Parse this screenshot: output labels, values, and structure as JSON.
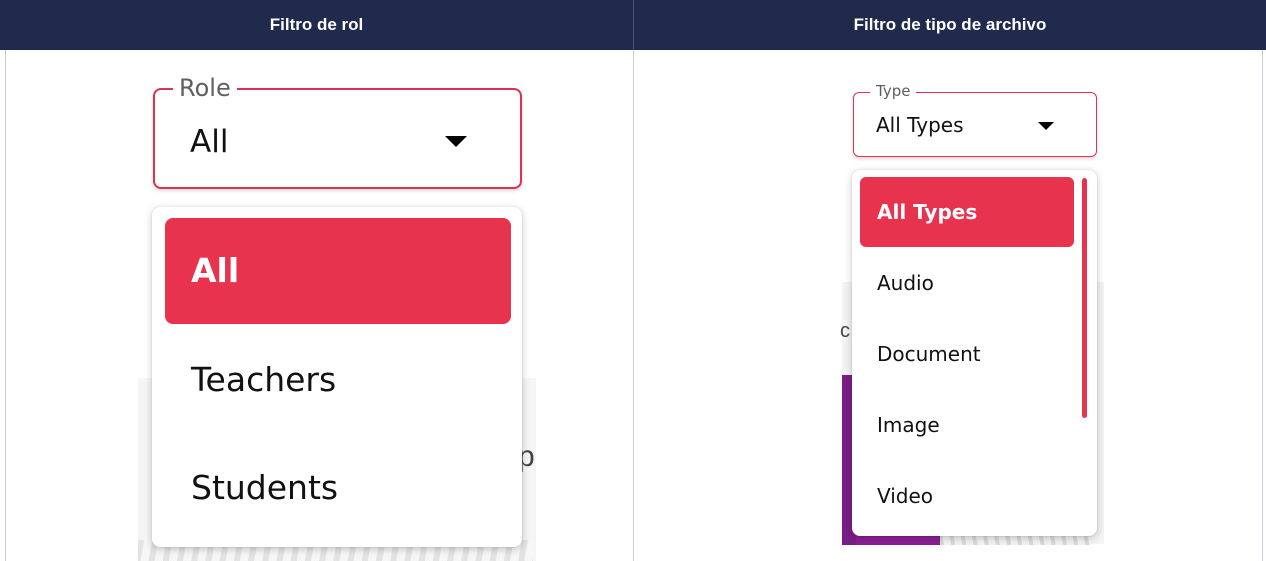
{
  "header": {
    "left_title": "Filtro de rol",
    "right_title": "Filtro de tipo de archivo"
  },
  "role_filter": {
    "legend": "Role",
    "value": "All",
    "options": [
      "All",
      "Teachers",
      "Students"
    ],
    "selected_index": 0
  },
  "type_filter": {
    "legend": "Type",
    "value": "All Types",
    "options": [
      "All Types",
      "Audio",
      "Document",
      "Image",
      "Video"
    ],
    "selected_index": 0
  },
  "colors": {
    "header_bg": "#1f2a4d",
    "accent": "#e8334f",
    "field_border": "#e0314f"
  },
  "icons": {
    "dropdown_caret": "caret-down-icon"
  }
}
